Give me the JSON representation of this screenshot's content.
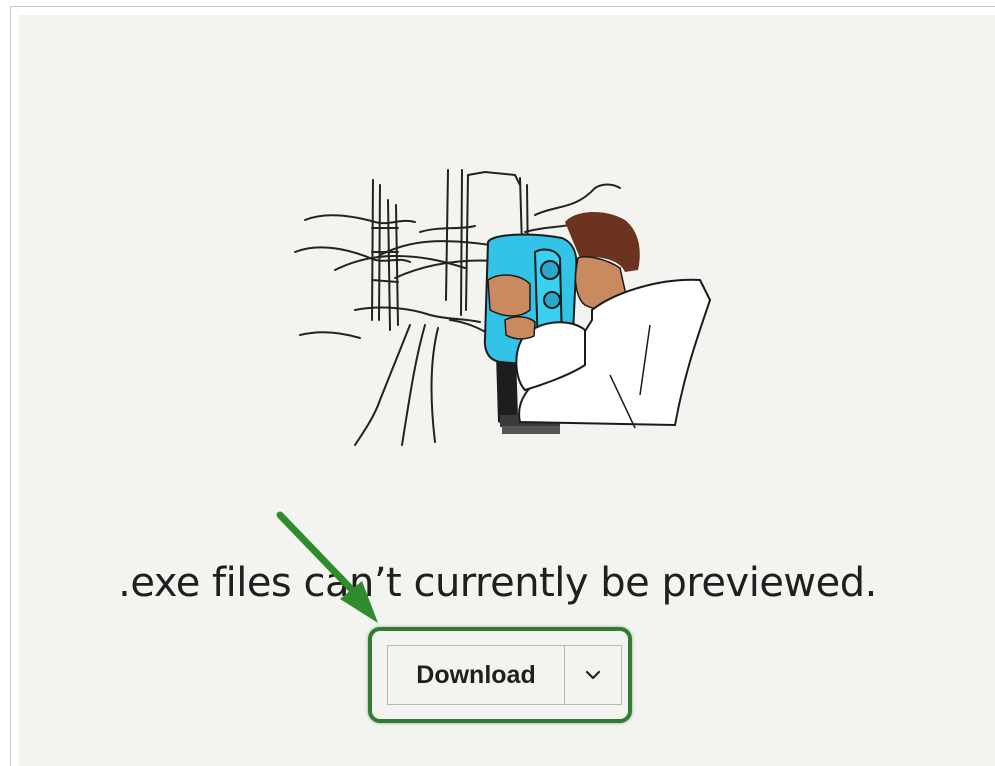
{
  "preview": {
    "message": ".exe files can’t currently be previewed.",
    "illustration": "person-with-binoculars-illustration"
  },
  "actions": {
    "download_label": "Download",
    "dropdown_icon": "chevron-down-icon"
  },
  "annotation": {
    "arrow_color": "#2e8b2e",
    "highlight_color": "#2e7d32"
  },
  "colors": {
    "background": "#f3f3ef",
    "binocular_accent": "#33c3e6",
    "hair": "#6b3320"
  }
}
